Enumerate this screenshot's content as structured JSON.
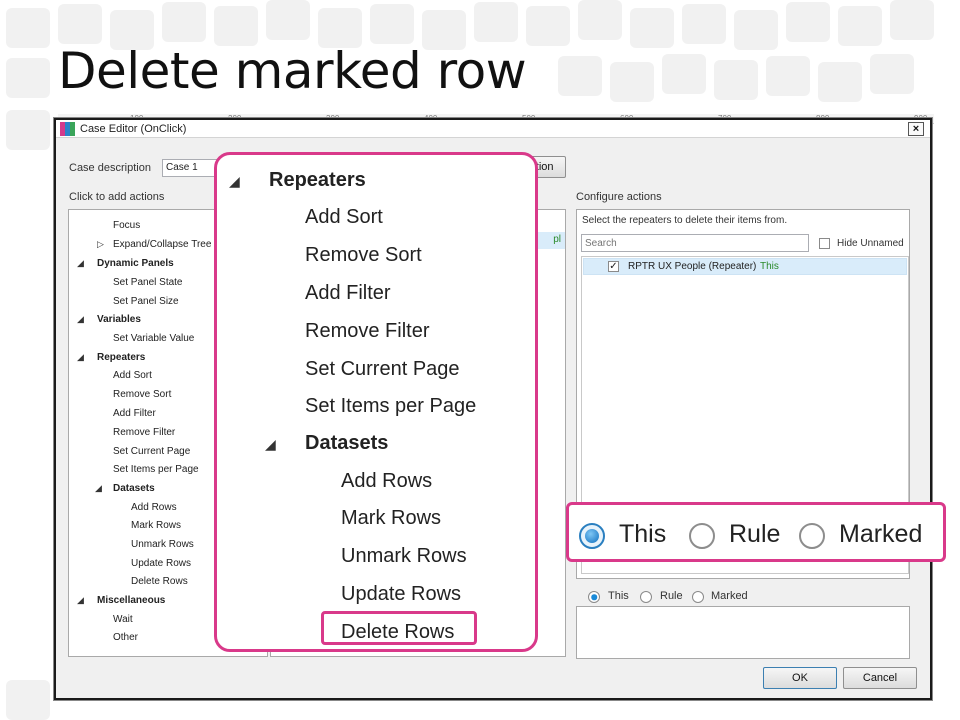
{
  "slide": {
    "title": "Delete marked row"
  },
  "ruler": {
    "ticks": [
      "100",
      "200",
      "300",
      "400",
      "500",
      "600",
      "700",
      "800",
      "900"
    ]
  },
  "dialog": {
    "title": "Case Editor (OnClick)",
    "close_glyph": "×",
    "case_description_label": "Case description",
    "case_description_value": "Case 1",
    "add_condition_label": "Add Condition",
    "click_to_add_label": "Click to add actions",
    "configure_label": "Configure actions",
    "ok_label": "OK",
    "cancel_label": "Cancel"
  },
  "tree": {
    "focus": "Focus",
    "expand_collapse": "Expand/Collapse Tree",
    "dynamic_panels": "Dynamic Panels",
    "set_panel_state": "Set Panel State",
    "set_panel_size": "Set Panel Size",
    "variables": "Variables",
    "set_variable_value": "Set Variable Value",
    "repeaters": "Repeaters",
    "add_sort": "Add Sort",
    "remove_sort": "Remove Sort",
    "add_filter": "Add Filter",
    "remove_filter": "Remove Filter",
    "set_current_page": "Set Current Page",
    "set_items_per_page": "Set Items per Page",
    "datasets": "Datasets",
    "add_rows": "Add Rows",
    "mark_rows": "Mark Rows",
    "unmark_rows": "Unmark Rows",
    "update_rows": "Update Rows",
    "delete_rows": "Delete Rows",
    "miscellaneous": "Miscellaneous",
    "wait": "Wait",
    "other": "Other"
  },
  "middle": {
    "snippet": "pl"
  },
  "configure": {
    "instruction": "Select the repeaters to delete their items from.",
    "search_placeholder": "Search",
    "hide_unnamed_label": "Hide Unnamed",
    "repeater_name": "RPTR UX People (Repeater)",
    "repeater_suffix": "This",
    "radio_this": "This",
    "radio_rule": "Rule",
    "radio_marked": "Marked",
    "selected": "This"
  },
  "zoom_menu": {
    "repeaters": "Repeaters",
    "add_sort": "Add Sort",
    "remove_sort": "Remove Sort",
    "add_filter": "Add Filter",
    "remove_filter": "Remove Filter",
    "set_current_page": "Set Current Page",
    "set_items_per_page": "Set Items per Page",
    "datasets": "Datasets",
    "add_rows": "Add Rows",
    "mark_rows": "Mark Rows",
    "unmark_rows": "Unmark Rows",
    "update_rows": "Update Rows",
    "delete_rows": "Delete Rows"
  },
  "zoom_radio": {
    "this": "This",
    "rule": "Rule",
    "marked": "Marked"
  },
  "colors": {
    "accent": "#d9398a",
    "selection": "#d9ecfa",
    "repeater_suffix": "#2a8a2a"
  },
  "icons": {
    "collapse_triangle": "◢",
    "expand_triangle": "▷",
    "checkmark": "✓"
  }
}
